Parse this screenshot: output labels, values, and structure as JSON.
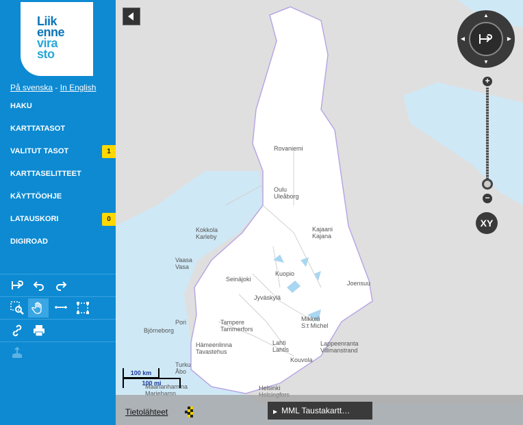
{
  "logo": {
    "lines": [
      "Liik",
      "enne",
      "vira",
      "sto"
    ]
  },
  "languages": {
    "swedish": "På svenska",
    "separator": "-",
    "english": "In English"
  },
  "menu": [
    {
      "label": "HAKU"
    },
    {
      "label": "KARTTATASOT"
    },
    {
      "label": "VALITUT TASOT",
      "badge": "1"
    },
    {
      "label": "KARTTASELITTEET"
    },
    {
      "label": "KÄYTTÖOHJE"
    },
    {
      "label": "LATAUSKORI",
      "badge": "0"
    },
    {
      "label": "DIGIROAD"
    }
  ],
  "tools": {
    "row1": [
      "reset-view-icon",
      "undo-icon",
      "redo-icon"
    ],
    "row2": [
      "zoom-box-icon",
      "pan-hand-icon",
      "measure-line-icon",
      "measure-area-icon"
    ],
    "row3": [
      "link-icon",
      "print-icon"
    ],
    "row4": [
      "upload-layer-icon"
    ]
  },
  "map": {
    "cities": [
      "Rovaniemi",
      "Oulu",
      "Uleåborg",
      "Kokkola",
      "Karleby",
      "Kajaani",
      "Kajana",
      "Vaasa",
      "Vasa",
      "Seinäjoki",
      "Kuopio",
      "Joensuu",
      "Jyväskylä",
      "Pori",
      "Björneborg",
      "Tampere",
      "Tammerfors",
      "Mikkeli",
      "S:t Michel",
      "Hämeenlinna",
      "Tavastehus",
      "Lahti",
      "Lahtis",
      "Lappeenranta",
      "Villmanstrand",
      "Kouvola",
      "Turku",
      "Åbo",
      "Maarianhamina",
      "Mariehamn",
      "Helsinki",
      "Helsingfors"
    ],
    "scale": {
      "km": "100 km",
      "mi": "100 mi"
    },
    "zoom_in": "+",
    "zoom_out": "−",
    "xy_label": "XY",
    "attribution_link": "Tietolähteet",
    "background_layer": "MML Taustakartt…"
  },
  "colors": {
    "sidebar": "#0d8ad2",
    "badge": "#ffd800",
    "sea": "#cfe8f6",
    "land": "#ffffff",
    "foreign_land": "#dfdfdf",
    "controls": "#3a3a3a"
  }
}
